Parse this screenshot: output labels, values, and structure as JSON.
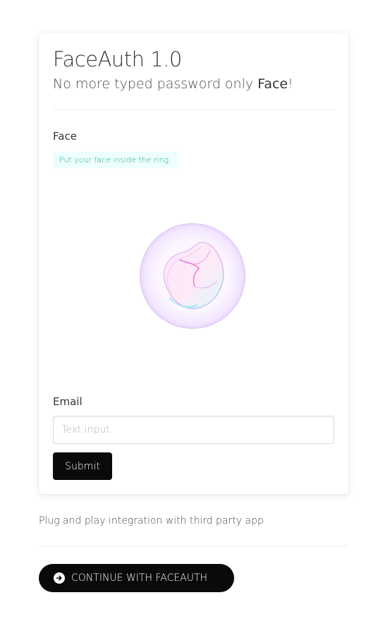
{
  "card": {
    "title": "FaceAuth 1.0",
    "subtitle_prefix": "No more typed password only ",
    "subtitle_strong": "Face",
    "subtitle_suffix": "!"
  },
  "face_section": {
    "label": "Face",
    "notice": "Put your face inside the ring.",
    "ring_icon": "face-scan-ring-icon"
  },
  "email_section": {
    "label": "Email",
    "placeholder": "Text input",
    "value": ""
  },
  "submit_label": "Submit",
  "footer": {
    "text": "Plug and play integration with third party app",
    "cta_label": "CONTINUE WITH FACEAUTH",
    "cta_icon": "arrow-circle-right-icon"
  },
  "colors": {
    "button_bg": "#0a0a0a",
    "notice_bg": "#ebfffc",
    "notice_text": "#00947e",
    "ring_purple": "#c9a7f5",
    "ring_pink": "#f07ad0",
    "ring_cyan": "#7fe6ef"
  }
}
